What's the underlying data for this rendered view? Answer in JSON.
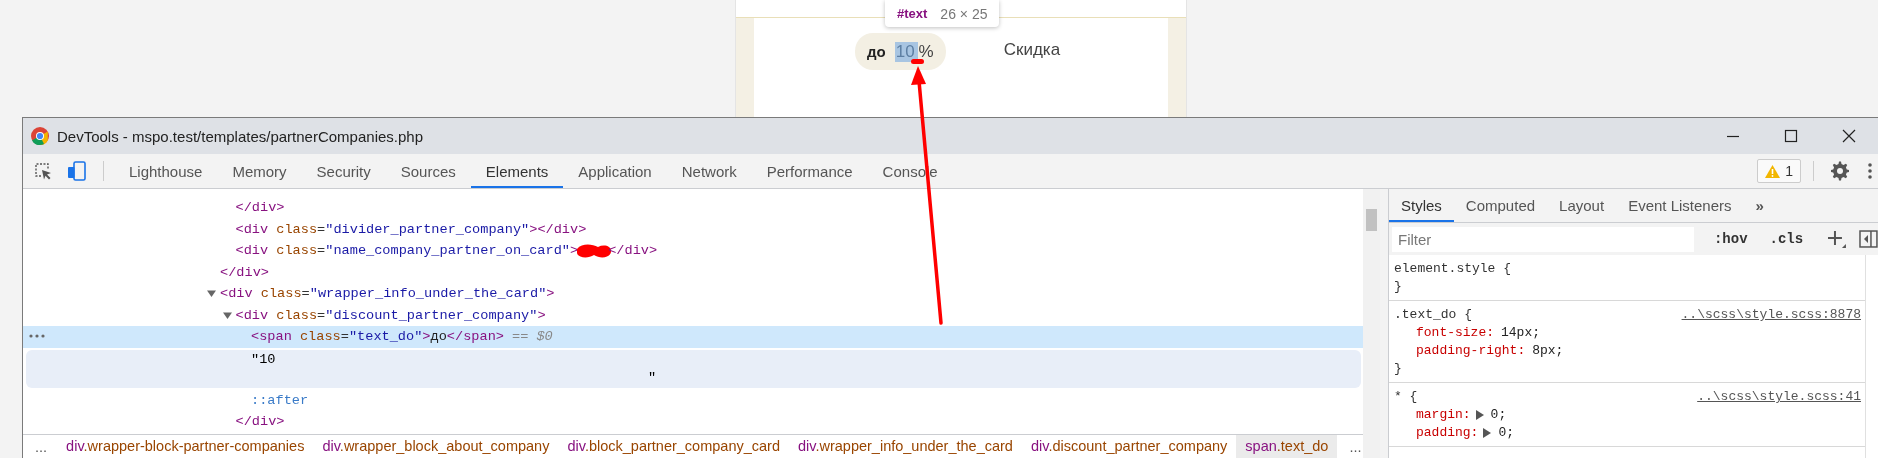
{
  "page": {
    "discount_badge": {
      "prefix": "до",
      "value": "10",
      "suffix": "%"
    },
    "discount_label": "Скидка",
    "inspect_tooltip": {
      "node": "#text",
      "size": "26 × 25"
    }
  },
  "devtools": {
    "title": "DevTools - mspo.test/templates/partnerCompanies.php",
    "tabs": [
      {
        "label": "Lighthouse",
        "selected": false
      },
      {
        "label": "Memory",
        "selected": false
      },
      {
        "label": "Security",
        "selected": false
      },
      {
        "label": "Sources",
        "selected": false
      },
      {
        "label": "Elements",
        "selected": true
      },
      {
        "label": "Application",
        "selected": false
      },
      {
        "label": "Network",
        "selected": false
      },
      {
        "label": "Performance",
        "selected": false
      },
      {
        "label": "Console",
        "selected": false
      }
    ],
    "warning_count": "1",
    "dom_tree": [
      {
        "kind": "element",
        "close": "</div>",
        "children": [
          {
            "kind": "leaf",
            "selected": false,
            "line": "</div>"
          },
          {
            "kind": "leaf",
            "selected": false,
            "line": "<div class=\"divider_partner_company\"></div>"
          },
          {
            "kind": "leaf",
            "selected": false,
            "line": "<div class=\"name_company_partner_on_card\">",
            "redacted": true,
            "tail": "</div>"
          }
        ]
      },
      {
        "kind": "element",
        "open": "<div class=\"wrapper_info_under_the_card\">",
        "expanded": true,
        "children": [
          {
            "kind": "element",
            "open": "<div class=\"discount_partner_company\">",
            "expanded": true,
            "close": "</div>",
            "children": [
              {
                "kind": "leaf",
                "selected": true,
                "line": "<span class=\"text_do\">до</span>",
                "note": "== $0"
              },
              {
                "kind": "text",
                "selected": false,
                "first": "\"10",
                "last": "\""
              },
              {
                "kind": "pseudo",
                "selected": false,
                "line": "::after"
              }
            ]
          }
        ]
      }
    ],
    "breadcrumbs_overflow_left": "...",
    "breadcrumbs": [
      {
        "tag": "div",
        "cls": ".wrapper-block-partner-companies",
        "selected": false
      },
      {
        "tag": "div",
        "cls": ".wrapper_block_about_company",
        "selected": false
      },
      {
        "tag": "div",
        "cls": ".block_partner_company_card",
        "selected": false
      },
      {
        "tag": "div",
        "cls": ".wrapper_info_under_the_card",
        "selected": false
      },
      {
        "tag": "div",
        "cls": ".discount_partner_company",
        "selected": false
      },
      {
        "tag": "span",
        "cls": ".text_do",
        "selected": true
      }
    ],
    "breadcrumbs_overflow_right": "...",
    "sidebar_tabs": [
      {
        "label": "Styles",
        "selected": true
      },
      {
        "label": "Computed",
        "selected": false
      },
      {
        "label": "Layout",
        "selected": false
      },
      {
        "label": "Event Listeners",
        "selected": false
      }
    ],
    "sidebar_more": "»",
    "filter": {
      "placeholder": "Filter"
    },
    "filter_buttons": [
      ":hov",
      ".cls"
    ],
    "rules": [
      {
        "selector": "element.style {",
        "close": "}"
      },
      {
        "selector": ".text_do {",
        "source": "..\\scss\\style.scss:8878",
        "close": "}",
        "properties": [
          {
            "name": "font-size:",
            "value": "14px;",
            "expandable": false
          },
          {
            "name": "padding-right:",
            "value": "8px;",
            "expandable": false
          }
        ]
      },
      {
        "selector": "* {",
        "source": "..\\scss\\style.scss:41",
        "properties": [
          {
            "name": "margin:",
            "value": "0;",
            "expandable": true
          },
          {
            "name": "padding:",
            "value": "0;",
            "expandable": true
          }
        ]
      }
    ]
  }
}
